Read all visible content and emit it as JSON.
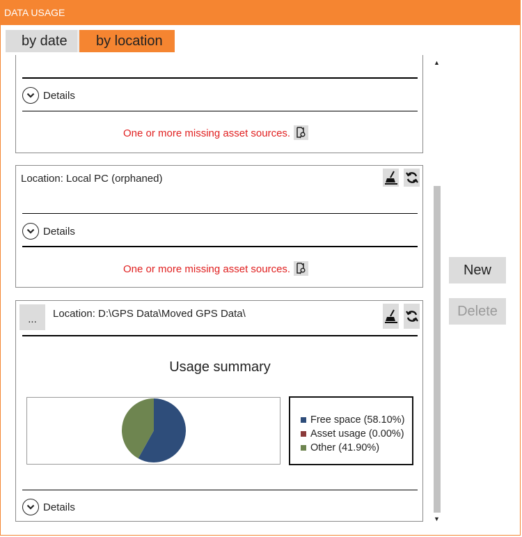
{
  "window": {
    "title": "DATA USAGE"
  },
  "tabs": {
    "by_date": "by date",
    "by_location": "by location"
  },
  "panel1": {
    "details_label": "Details",
    "warning": "One or more missing asset sources."
  },
  "panel2": {
    "location": "Location: Local PC (orphaned)",
    "details_label": "Details",
    "warning": "One or more missing asset sources."
  },
  "panel3": {
    "more_label": "...",
    "location": "Location: D:\\GPS Data\\Moved GPS Data\\",
    "summary_title": "Usage summary",
    "details_label": "Details"
  },
  "chart_data": {
    "type": "pie",
    "title": "",
    "series": [
      {
        "name": "Free space (58.10%)",
        "value": 58.1,
        "color": "#2e4d7a"
      },
      {
        "name": "Asset usage (0.00%)",
        "value": 0.0,
        "color": "#8b3a3a"
      },
      {
        "name": "Other (41.90%)",
        "value": 41.9,
        "color": "#6e8550"
      }
    ]
  },
  "actions": {
    "new_label": "New",
    "delete_label": "Delete"
  },
  "colors": {
    "accent": "#f58531",
    "warning_text": "#e02020"
  }
}
